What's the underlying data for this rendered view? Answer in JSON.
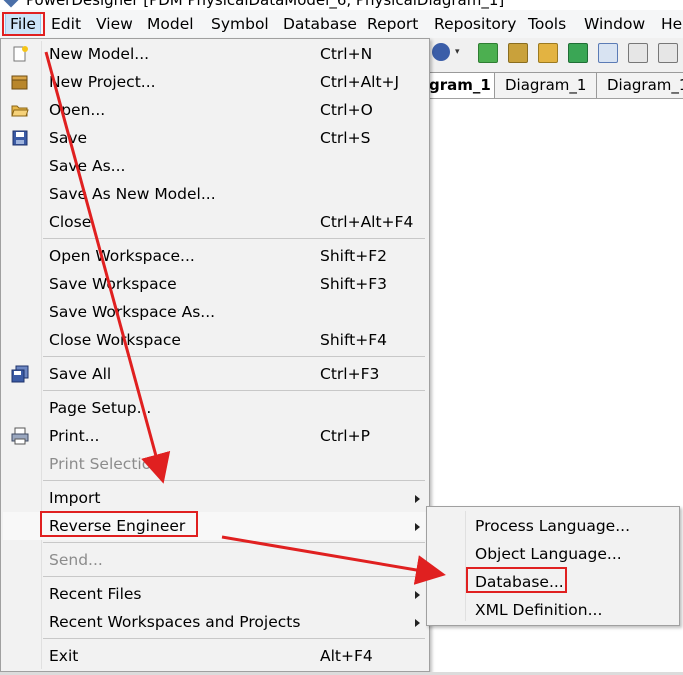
{
  "window": {
    "title": "PowerDesigner [PDM PhysicalDataModel_6, PhysicalDiagram_1]"
  },
  "menubar": {
    "items": [
      "File",
      "Edit",
      "View",
      "Model",
      "Symbol",
      "Database",
      "Report",
      "Repository",
      "Tools",
      "Window",
      "He"
    ],
    "active": "File"
  },
  "toolbar": {
    "icons": [
      "help-icon",
      "new-icon",
      "project-icon",
      "find-icon",
      "refresh-icon",
      "check-icon",
      "window-icon",
      "grid-icon"
    ]
  },
  "tabs": [
    {
      "label": "gram_1",
      "active": true
    },
    {
      "label": "Diagram_1",
      "active": false
    },
    {
      "label": "Diagram_1",
      "active": false
    }
  ],
  "file_menu": {
    "items": [
      {
        "label": "New Model...",
        "shortcut": "Ctrl+N",
        "icon": "new-model-icon"
      },
      {
        "label": "New Project...",
        "shortcut": "Ctrl+Alt+J",
        "icon": "new-project-icon"
      },
      {
        "label": "Open...",
        "shortcut": "Ctrl+O",
        "icon": "open-folder-icon"
      },
      {
        "label": "Save",
        "shortcut": "Ctrl+S",
        "icon": "save-icon"
      },
      {
        "label": "Save As...",
        "shortcut": ""
      },
      {
        "label": "Save As New Model...",
        "shortcut": ""
      },
      {
        "label": "Close",
        "shortcut": "Ctrl+Alt+F4"
      },
      {
        "label": "Open Workspace...",
        "shortcut": "Shift+F2"
      },
      {
        "label": "Save Workspace",
        "shortcut": "Shift+F3"
      },
      {
        "label": "Save Workspace As...",
        "shortcut": ""
      },
      {
        "label": "Close Workspace",
        "shortcut": "Shift+F4"
      },
      {
        "label": "Save All",
        "shortcut": "Ctrl+F3",
        "icon": "save-all-icon"
      },
      {
        "label": "Page Setup...",
        "shortcut": ""
      },
      {
        "label": "Print...",
        "shortcut": "Ctrl+P",
        "icon": "printer-icon"
      },
      {
        "label": "Print Selection",
        "shortcut": "",
        "disabled": true
      },
      {
        "label": "Import",
        "shortcut": "",
        "submenu": true
      },
      {
        "label": "Reverse Engineer",
        "shortcut": "",
        "submenu": true,
        "highlighted": true
      },
      {
        "label": "Send...",
        "shortcut": "",
        "disabled": true
      },
      {
        "label": "Recent Files",
        "shortcut": "",
        "submenu": true
      },
      {
        "label": "Recent Workspaces and Projects",
        "shortcut": "",
        "submenu": true
      },
      {
        "label": "Exit",
        "shortcut": "Alt+F4"
      }
    ]
  },
  "reverse_engineer_submenu": {
    "items": [
      {
        "label": "Process Language..."
      },
      {
        "label": "Object Language..."
      },
      {
        "label": "Database..."
      },
      {
        "label": "XML Definition..."
      }
    ]
  },
  "annotations": {
    "highlight_color": "#e02020",
    "boxed_items": [
      "File",
      "Reverse Engineer",
      "Database..."
    ]
  },
  "colors": {
    "menu_background": "#f2f2f2",
    "menubar_selected": "#cce4f7",
    "annotation_red": "#e02020",
    "disabled_text": "#8c8c8c"
  }
}
